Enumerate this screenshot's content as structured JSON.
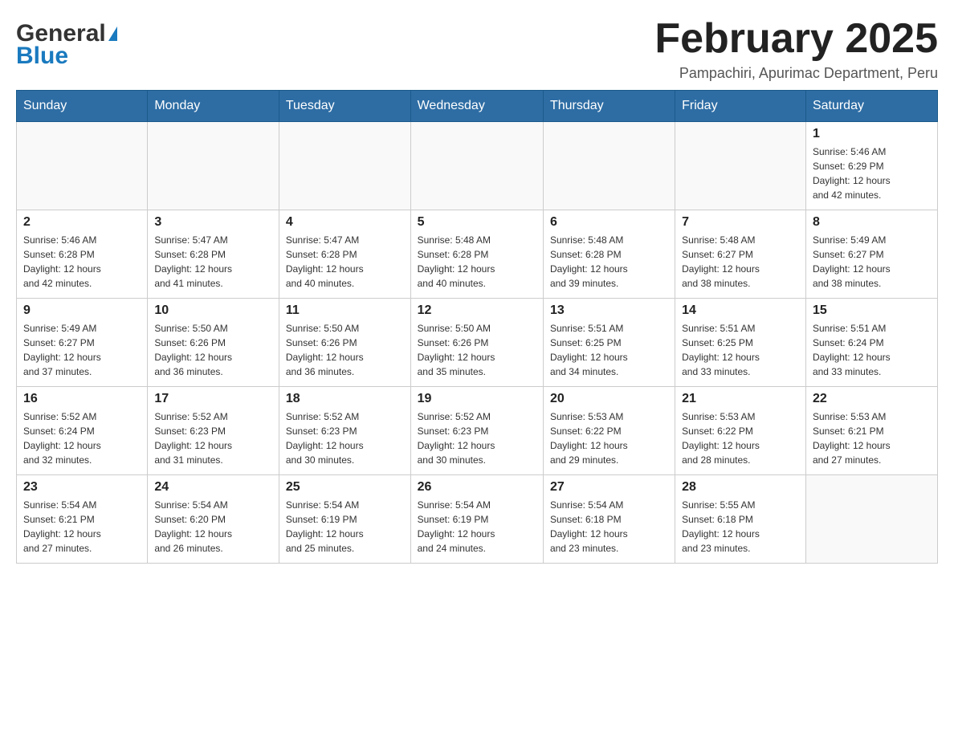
{
  "header": {
    "logo_general": "General",
    "logo_blue": "Blue",
    "title": "February 2025",
    "subtitle": "Pampachiri, Apurimac Department, Peru"
  },
  "days_of_week": [
    "Sunday",
    "Monday",
    "Tuesday",
    "Wednesday",
    "Thursday",
    "Friday",
    "Saturday"
  ],
  "weeks": [
    [
      {
        "day": "",
        "info": ""
      },
      {
        "day": "",
        "info": ""
      },
      {
        "day": "",
        "info": ""
      },
      {
        "day": "",
        "info": ""
      },
      {
        "day": "",
        "info": ""
      },
      {
        "day": "",
        "info": ""
      },
      {
        "day": "1",
        "info": "Sunrise: 5:46 AM\nSunset: 6:29 PM\nDaylight: 12 hours\nand 42 minutes."
      }
    ],
    [
      {
        "day": "2",
        "info": "Sunrise: 5:46 AM\nSunset: 6:28 PM\nDaylight: 12 hours\nand 42 minutes."
      },
      {
        "day": "3",
        "info": "Sunrise: 5:47 AM\nSunset: 6:28 PM\nDaylight: 12 hours\nand 41 minutes."
      },
      {
        "day": "4",
        "info": "Sunrise: 5:47 AM\nSunset: 6:28 PM\nDaylight: 12 hours\nand 40 minutes."
      },
      {
        "day": "5",
        "info": "Sunrise: 5:48 AM\nSunset: 6:28 PM\nDaylight: 12 hours\nand 40 minutes."
      },
      {
        "day": "6",
        "info": "Sunrise: 5:48 AM\nSunset: 6:28 PM\nDaylight: 12 hours\nand 39 minutes."
      },
      {
        "day": "7",
        "info": "Sunrise: 5:48 AM\nSunset: 6:27 PM\nDaylight: 12 hours\nand 38 minutes."
      },
      {
        "day": "8",
        "info": "Sunrise: 5:49 AM\nSunset: 6:27 PM\nDaylight: 12 hours\nand 38 minutes."
      }
    ],
    [
      {
        "day": "9",
        "info": "Sunrise: 5:49 AM\nSunset: 6:27 PM\nDaylight: 12 hours\nand 37 minutes."
      },
      {
        "day": "10",
        "info": "Sunrise: 5:50 AM\nSunset: 6:26 PM\nDaylight: 12 hours\nand 36 minutes."
      },
      {
        "day": "11",
        "info": "Sunrise: 5:50 AM\nSunset: 6:26 PM\nDaylight: 12 hours\nand 36 minutes."
      },
      {
        "day": "12",
        "info": "Sunrise: 5:50 AM\nSunset: 6:26 PM\nDaylight: 12 hours\nand 35 minutes."
      },
      {
        "day": "13",
        "info": "Sunrise: 5:51 AM\nSunset: 6:25 PM\nDaylight: 12 hours\nand 34 minutes."
      },
      {
        "day": "14",
        "info": "Sunrise: 5:51 AM\nSunset: 6:25 PM\nDaylight: 12 hours\nand 33 minutes."
      },
      {
        "day": "15",
        "info": "Sunrise: 5:51 AM\nSunset: 6:24 PM\nDaylight: 12 hours\nand 33 minutes."
      }
    ],
    [
      {
        "day": "16",
        "info": "Sunrise: 5:52 AM\nSunset: 6:24 PM\nDaylight: 12 hours\nand 32 minutes."
      },
      {
        "day": "17",
        "info": "Sunrise: 5:52 AM\nSunset: 6:23 PM\nDaylight: 12 hours\nand 31 minutes."
      },
      {
        "day": "18",
        "info": "Sunrise: 5:52 AM\nSunset: 6:23 PM\nDaylight: 12 hours\nand 30 minutes."
      },
      {
        "day": "19",
        "info": "Sunrise: 5:52 AM\nSunset: 6:23 PM\nDaylight: 12 hours\nand 30 minutes."
      },
      {
        "day": "20",
        "info": "Sunrise: 5:53 AM\nSunset: 6:22 PM\nDaylight: 12 hours\nand 29 minutes."
      },
      {
        "day": "21",
        "info": "Sunrise: 5:53 AM\nSunset: 6:22 PM\nDaylight: 12 hours\nand 28 minutes."
      },
      {
        "day": "22",
        "info": "Sunrise: 5:53 AM\nSunset: 6:21 PM\nDaylight: 12 hours\nand 27 minutes."
      }
    ],
    [
      {
        "day": "23",
        "info": "Sunrise: 5:54 AM\nSunset: 6:21 PM\nDaylight: 12 hours\nand 27 minutes."
      },
      {
        "day": "24",
        "info": "Sunrise: 5:54 AM\nSunset: 6:20 PM\nDaylight: 12 hours\nand 26 minutes."
      },
      {
        "day": "25",
        "info": "Sunrise: 5:54 AM\nSunset: 6:19 PM\nDaylight: 12 hours\nand 25 minutes."
      },
      {
        "day": "26",
        "info": "Sunrise: 5:54 AM\nSunset: 6:19 PM\nDaylight: 12 hours\nand 24 minutes."
      },
      {
        "day": "27",
        "info": "Sunrise: 5:54 AM\nSunset: 6:18 PM\nDaylight: 12 hours\nand 23 minutes."
      },
      {
        "day": "28",
        "info": "Sunrise: 5:55 AM\nSunset: 6:18 PM\nDaylight: 12 hours\nand 23 minutes."
      },
      {
        "day": "",
        "info": ""
      }
    ]
  ]
}
